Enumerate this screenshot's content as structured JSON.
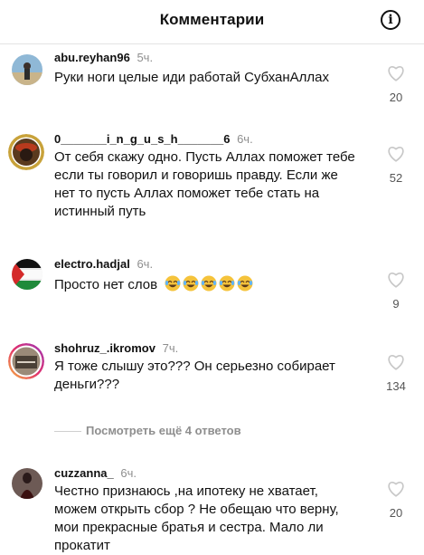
{
  "header": {
    "title": "Комментарии",
    "info_icon": "info-icon"
  },
  "comments": [
    {
      "username": "abu.reyhan96",
      "time": "5ч.",
      "text": "Руки ноги целые иди работай СубханАллах",
      "likes": "20"
    },
    {
      "username": "0_______i_n_g_u_s_h_______6",
      "time": "6ч.",
      "text": "От себя скажу одно. Пусть Аллах поможет тебе если ты говорил и говоришь правду. Если же нет то пусть Аллах поможет тебе стать на истинный путь",
      "likes": "52"
    },
    {
      "username": "electro.hadjal",
      "time": "6ч.",
      "text": "Просто нет слов",
      "likes": "9"
    },
    {
      "username": "shohruz_.ikromov",
      "time": "7ч.",
      "text": "Я тоже слышу это??? Он серьезно собирает деньги???",
      "likes": "134"
    },
    {
      "username": "cuzzanna_",
      "time": "6ч.",
      "text": "Честно признаюсь ,на ипотеку не хватает, можем открыть сбор ? Не обещаю что верну, мои прекрасные братья и сестра. Мало ли прокатит",
      "likes": "20"
    }
  ],
  "view_more": {
    "label": "Посмотреть ещё 4 ответов"
  },
  "colors": {
    "muted": "#8e8e8e",
    "heart_outline": "#c7c7c7",
    "divider": "#e4e4e4"
  }
}
